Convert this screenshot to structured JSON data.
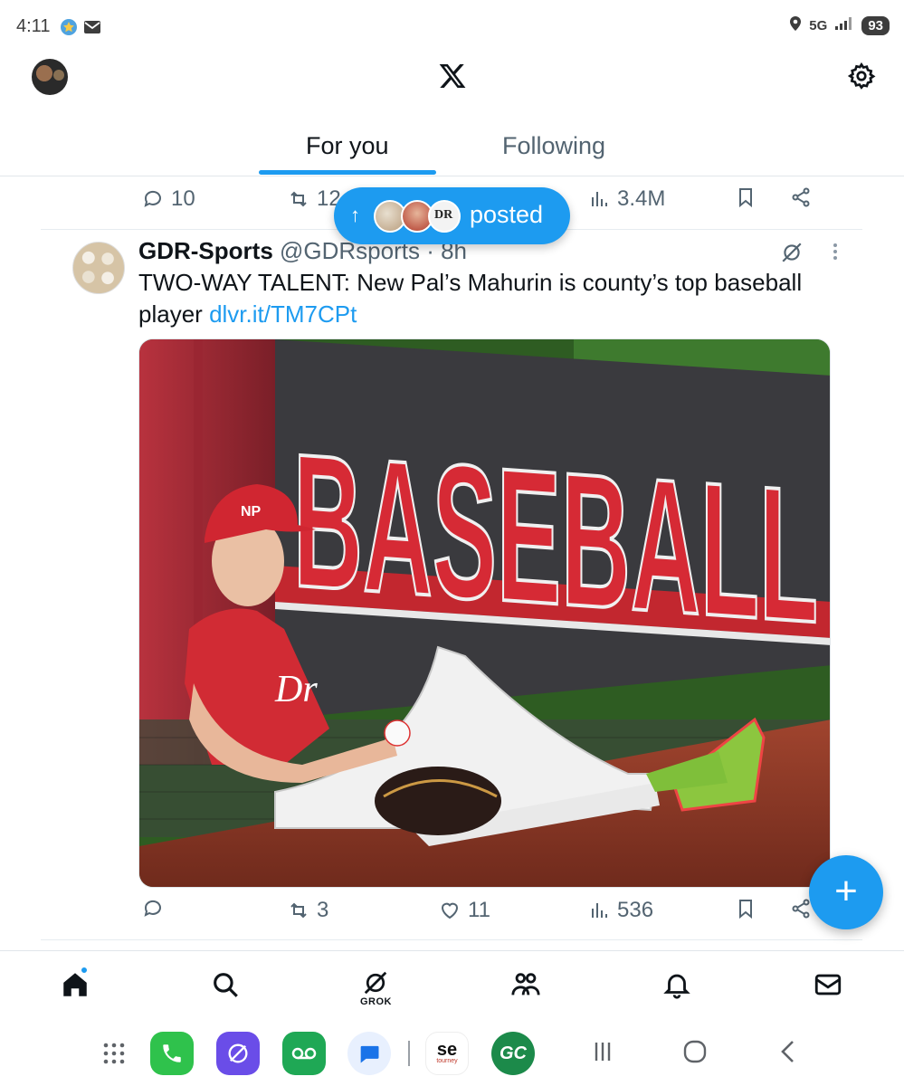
{
  "status": {
    "time": "4:11",
    "network": "5G",
    "battery": "93"
  },
  "header": {
    "logo": "X"
  },
  "tabs": [
    {
      "label": "For you",
      "active": true
    },
    {
      "label": "Following",
      "active": false
    }
  ],
  "previous_tweet_actions": {
    "replies": "10",
    "reposts": "12",
    "views": "3.4M"
  },
  "posted_pill": {
    "label": "posted",
    "avatar_3_text": "DR"
  },
  "tweet": {
    "name": "GDR-Sports",
    "handle_time": "@GDRsports · 8h",
    "text": "TWO-WAY TALENT: New Pal’s Mahurin is county’s top baseball player",
    "link": "dlvr.it/TM7CPt",
    "image_alt": "Baseball player in red jersey sitting against outfield wall with BASEBALL banner",
    "banner_text": "BASEBALL",
    "jersey_text": "Dr",
    "cap_text": "NP",
    "actions": {
      "replies": "",
      "reposts": "3",
      "likes": "11",
      "views": "536"
    }
  },
  "fab": {
    "label": "+"
  },
  "bottom_nav": {
    "grok_label": "GROK"
  },
  "dock": {
    "se_top": "se",
    "se_bottom": "tourney",
    "gc": "GC"
  },
  "colors": {
    "accent": "#1d9bf0",
    "text": "#0f1419",
    "muted": "#536471"
  }
}
